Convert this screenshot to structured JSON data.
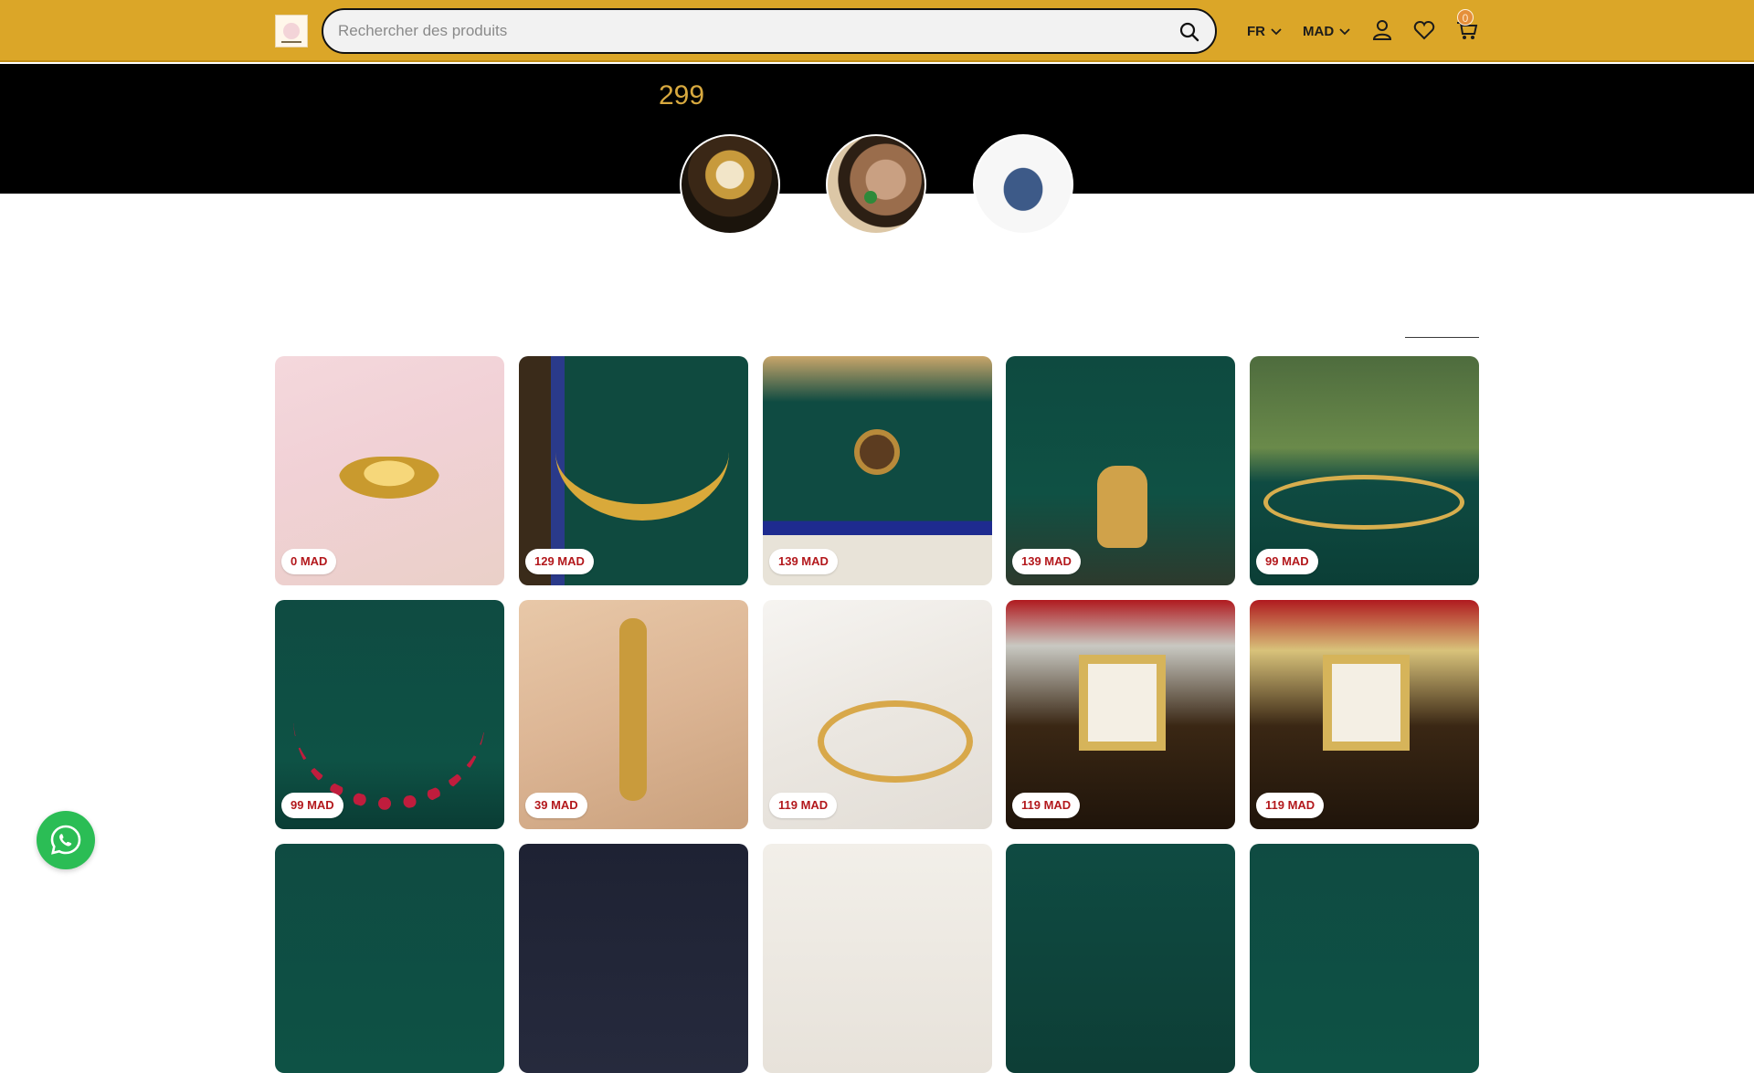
{
  "header": {
    "logo_name": "logo",
    "search": {
      "placeholder": "Rechercher des produits"
    },
    "language": "FR",
    "currency": "MAD",
    "cart_count": "0",
    "colors": {
      "bar": "#dba628",
      "text": "#1b1b1b"
    }
  },
  "banner": {
    "price_text": "299",
    "stories": [
      {
        "name": "story-watch"
      },
      {
        "name": "story-hand-jewelry"
      },
      {
        "name": "story-denim-dress"
      }
    ]
  },
  "products": [
    {
      "price": "0 MAD"
    },
    {
      "price": "129 MAD"
    },
    {
      "price": "139 MAD"
    },
    {
      "price": "139 MAD"
    },
    {
      "price": "99 MAD"
    },
    {
      "price": "99 MAD"
    },
    {
      "price": "39 MAD"
    },
    {
      "price": "119 MAD"
    },
    {
      "price": "119 MAD"
    },
    {
      "price": "119 MAD"
    }
  ],
  "icons": [
    "search-icon",
    "chevron-down-icon",
    "user-icon",
    "heart-icon",
    "cart-icon",
    "whatsapp-icon"
  ]
}
